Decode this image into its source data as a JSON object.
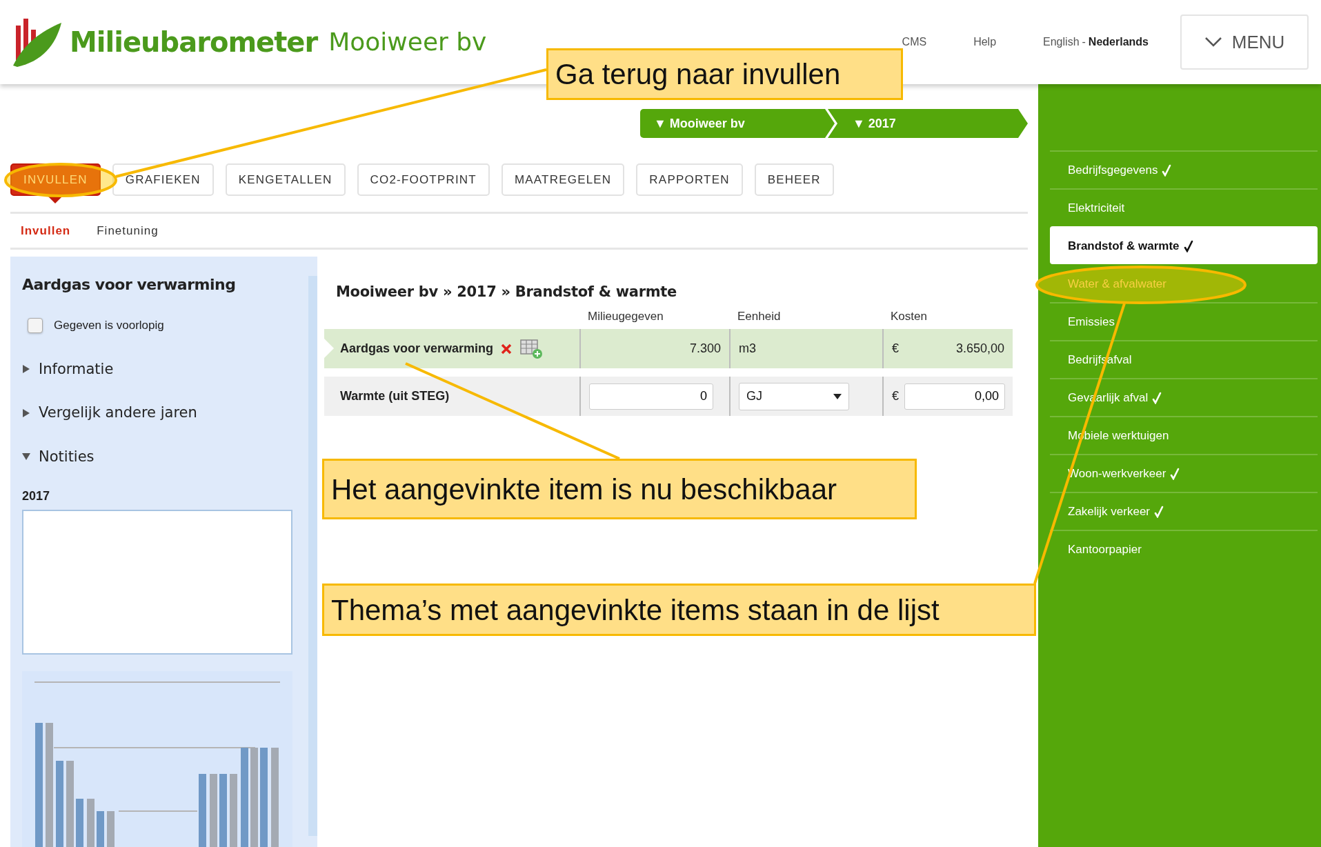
{
  "header": {
    "brand": "Milieubarometer",
    "company": "Mooiweer bv",
    "links": [
      "CMS",
      "Help"
    ],
    "languages": [
      {
        "label": "English",
        "selected": false
      },
      {
        "label": "Nederlands",
        "selected": true
      }
    ],
    "language_separator": "-",
    "menu_button": "MENU"
  },
  "breadcrumb": [
    "▼ Mooiweer bv",
    "▼ 2017"
  ],
  "tabs": [
    {
      "label": "INVULLEN",
      "selected": true
    },
    {
      "label": "GRAFIEKEN",
      "selected": false
    },
    {
      "label": "KENGETALLEN",
      "selected": false
    },
    {
      "label": "CO2-FOOTPRINT",
      "selected": false
    },
    {
      "label": "MAATREGELEN",
      "selected": false
    },
    {
      "label": "RAPPORTEN",
      "selected": false
    },
    {
      "label": "BEHEER",
      "selected": false
    }
  ],
  "subtabs": [
    {
      "label": "Invullen",
      "selected": true
    },
    {
      "label": "Finetuning",
      "selected": false
    }
  ],
  "left_panel": {
    "title": "Aardgas voor verwarming",
    "checkbox": {
      "label": "Gegeven is voorlopig",
      "checked": false
    },
    "sections": [
      {
        "label": "Informatie",
        "expanded": false
      },
      {
        "label": "Vergelijk andere jaren",
        "expanded": false
      },
      {
        "label": "Notities",
        "expanded": true
      }
    ],
    "notes_label": "2017"
  },
  "table": {
    "title": "Mooiweer bv » 2017 » Brandstof & warmte",
    "columns": [
      "Milieugegeven",
      "Eenheid",
      "Kosten"
    ],
    "rows": [
      {
        "kind": "readonly",
        "label": "Aardgas voor verwarming",
        "selected": true,
        "value": "7.300",
        "unit": "m3",
        "currency": "€",
        "cost": "3.650,00"
      },
      {
        "kind": "input",
        "label": "Warmte (uit STEG)",
        "selected": false,
        "value": "0",
        "unit": "GJ",
        "currency": "€",
        "cost": "0,00"
      }
    ]
  },
  "sidebar": {
    "items": [
      {
        "label": "Bedrijfsgegevens",
        "checked": true,
        "selected": false,
        "highlighted": false
      },
      {
        "label": "Elektriciteit",
        "checked": false,
        "selected": false,
        "highlighted": false
      },
      {
        "label": "Brandstof & warmte",
        "checked": true,
        "selected": true,
        "highlighted": false
      },
      {
        "label": "Water & afvalwater",
        "checked": false,
        "selected": false,
        "highlighted": true
      },
      {
        "label": "Emissies",
        "checked": false,
        "selected": false,
        "highlighted": false
      },
      {
        "label": "Bedrijfsafval",
        "checked": false,
        "selected": false,
        "highlighted": false
      },
      {
        "label": "Gevaarlijk afval",
        "checked": true,
        "selected": false,
        "highlighted": false
      },
      {
        "label": "Mobiele werktuigen",
        "checked": false,
        "selected": false,
        "highlighted": false
      },
      {
        "label": "Woon-werkverkeer",
        "checked": true,
        "selected": false,
        "highlighted": false
      },
      {
        "label": "Zakelijk verkeer",
        "checked": true,
        "selected": false,
        "highlighted": false
      },
      {
        "label": "Kantoorpapier",
        "checked": false,
        "selected": false,
        "highlighted": false
      }
    ]
  },
  "callouts": [
    {
      "text": "Ga terug naar invullen"
    },
    {
      "text": "Het aangevinkte item is nu beschikbaar"
    },
    {
      "text": "Thema’s met aangevinkte items staan in de lijst"
    }
  ]
}
